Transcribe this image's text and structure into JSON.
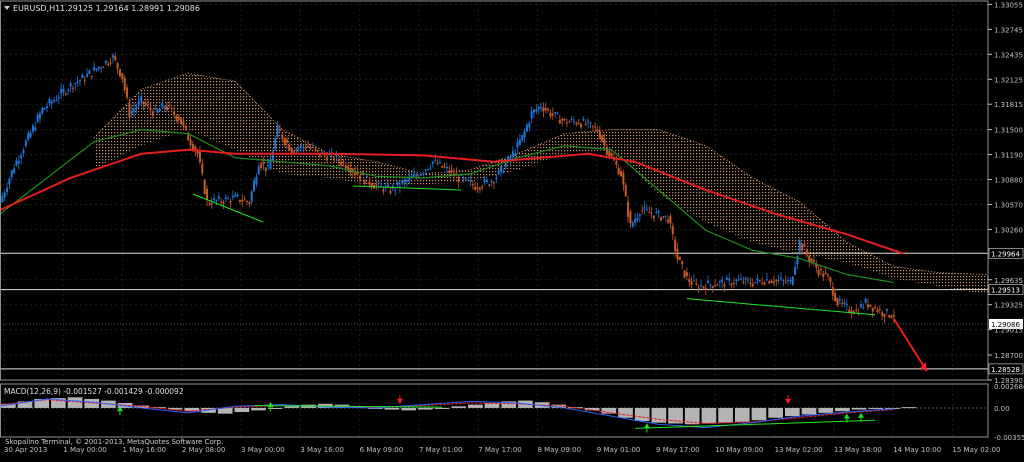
{
  "window": {
    "title": "EURUSD,H1",
    "ohlc": "1.29125 1.29164 1.28991 1.29086"
  },
  "colors": {
    "background": "#000000",
    "grid": "#1e1e1e",
    "axis": "#c0c0c0",
    "candle_up": "#1e78dc",
    "candle_down": "#c85a28",
    "ma_fast": "#1e8c1e",
    "ma_slow": "#e61e1e",
    "cloud": "#e6a078",
    "macd_hist": "#b4b4b4",
    "macd_signal": "#e61e1e",
    "macd_line": "#2d64ff",
    "trendline_green": "#1ee61e",
    "arrow_red": "#ff1e1e",
    "current_price_bg": "#ffffff",
    "current_price_text": "#000000"
  },
  "chart_data": [
    {
      "type": "candlestick",
      "symbol": "EURUSD",
      "timeframe": "H1",
      "ylim": [
        1.2839,
        1.3306
      ],
      "y_ticks": [
        "1.33055",
        "1.32745",
        "1.32435",
        "1.32125",
        "1.31815",
        "1.31500",
        "1.31190",
        "1.30880",
        "1.30570",
        "1.30260",
        "1.29635",
        "1.29325",
        "1.29015",
        "1.28700",
        "1.28390"
      ],
      "x_ticks": [
        "30 Apr 2013",
        "1 May 00:00",
        "1 May 16:00",
        "2 May 08:00",
        "3 May 00:00",
        "3 May 16:00",
        "6 May 09:00",
        "7 May 01:00",
        "7 May 17:00",
        "8 May 09:00",
        "9 May 01:00",
        "9 May 17:00",
        "10 May 09:00",
        "13 May 02:00",
        "13 May 18:00",
        "14 May 10:00",
        "15 May 02:00"
      ],
      "horizontal_levels": [
        {
          "value": 1.29964,
          "label": "1.29964"
        },
        {
          "value": 1.29513,
          "label": "1.29513"
        },
        {
          "value": 1.28528,
          "label": "1.28528"
        }
      ],
      "current_price": {
        "value": 1.29086,
        "label": "1.29086"
      },
      "close_path": [
        [
          0,
          1.306
        ],
        [
          6,
          1.3105
        ],
        [
          12,
          1.314
        ],
        [
          18,
          1.3175
        ],
        [
          24,
          1.319
        ],
        [
          30,
          1.3205
        ],
        [
          36,
          1.3215
        ],
        [
          42,
          1.3228
        ],
        [
          48,
          1.324
        ],
        [
          52,
          1.3215
        ],
        [
          55,
          1.317
        ],
        [
          60,
          1.3185
        ],
        [
          66,
          1.317
        ],
        [
          70,
          1.318
        ],
        [
          76,
          1.3165
        ],
        [
          80,
          1.314
        ],
        [
          84,
          1.312
        ],
        [
          88,
          1.306
        ],
        [
          94,
          1.3062
        ],
        [
          100,
          1.3065
        ],
        [
          106,
          1.306
        ],
        [
          110,
          1.311
        ],
        [
          114,
          1.31
        ],
        [
          118,
          1.315
        ],
        [
          124,
          1.3125
        ],
        [
          130,
          1.313
        ],
        [
          136,
          1.312
        ],
        [
          142,
          1.3115
        ],
        [
          148,
          1.3105
        ],
        [
          154,
          1.309
        ],
        [
          160,
          1.308
        ],
        [
          166,
          1.3075
        ],
        [
          172,
          1.3085
        ],
        [
          178,
          1.3095
        ],
        [
          184,
          1.311
        ],
        [
          190,
          1.31
        ],
        [
          196,
          1.3088
        ],
        [
          202,
          1.308
        ],
        [
          208,
          1.3085
        ],
        [
          212,
          1.3095
        ],
        [
          218,
          1.312
        ],
        [
          222,
          1.314
        ],
        [
          226,
          1.317
        ],
        [
          230,
          1.318
        ],
        [
          234,
          1.317
        ],
        [
          240,
          1.316
        ],
        [
          246,
          1.316
        ],
        [
          250,
          1.3155
        ],
        [
          254,
          1.315
        ],
        [
          258,
          1.3125
        ],
        [
          264,
          1.3095
        ],
        [
          268,
          1.303
        ],
        [
          272,
          1.305
        ],
        [
          278,
          1.3045
        ],
        [
          284,
          1.304
        ],
        [
          288,
          1.299
        ],
        [
          292,
          1.2965
        ],
        [
          296,
          1.2955
        ],
        [
          302,
          1.2958
        ],
        [
          308,
          1.296
        ],
        [
          314,
          1.2962
        ],
        [
          320,
          1.296
        ],
        [
          326,
          1.2964
        ],
        [
          332,
          1.2962
        ],
        [
          336,
          1.296
        ],
        [
          340,
          1.301
        ],
        [
          344,
          1.299
        ],
        [
          348,
          1.2975
        ],
        [
          352,
          1.2965
        ],
        [
          356,
          1.2935
        ],
        [
          360,
          1.2928
        ],
        [
          364,
          1.2925
        ],
        [
          368,
          1.2935
        ],
        [
          372,
          1.2928
        ],
        [
          376,
          1.2922
        ],
        [
          380,
          1.292
        ]
      ],
      "ma_fast_path": [
        [
          0,
          1.3045
        ],
        [
          20,
          1.309
        ],
        [
          40,
          1.3135
        ],
        [
          60,
          1.315
        ],
        [
          80,
          1.3145
        ],
        [
          100,
          1.3115
        ],
        [
          120,
          1.311
        ],
        [
          140,
          1.3105
        ],
        [
          160,
          1.3092
        ],
        [
          180,
          1.309
        ],
        [
          200,
          1.3095
        ],
        [
          220,
          1.3115
        ],
        [
          240,
          1.313
        ],
        [
          260,
          1.3125
        ],
        [
          280,
          1.3075
        ],
        [
          300,
          1.3025
        ],
        [
          320,
          1.3
        ],
        [
          340,
          1.299
        ],
        [
          360,
          1.297
        ],
        [
          380,
          1.296
        ]
      ],
      "ma_slow_path": [
        [
          0,
          1.305
        ],
        [
          30,
          1.309
        ],
        [
          60,
          1.312
        ],
        [
          80,
          1.3125
        ],
        [
          100,
          1.312
        ],
        [
          140,
          1.312
        ],
        [
          180,
          1.3118
        ],
        [
          210,
          1.311
        ],
        [
          230,
          1.3115
        ],
        [
          250,
          1.312
        ],
        [
          270,
          1.311
        ],
        [
          300,
          1.3075
        ],
        [
          330,
          1.3045
        ],
        [
          360,
          1.302
        ],
        [
          384,
          1.2996
        ]
      ],
      "cloud_upper": [
        [
          40,
          1.314
        ],
        [
          60,
          1.32
        ],
        [
          80,
          1.322
        ],
        [
          100,
          1.321
        ],
        [
          120,
          1.315
        ],
        [
          140,
          1.312
        ],
        [
          160,
          1.311
        ],
        [
          180,
          1.3095
        ],
        [
          200,
          1.31
        ],
        [
          220,
          1.312
        ],
        [
          240,
          1.3145
        ],
        [
          260,
          1.315
        ],
        [
          280,
          1.315
        ],
        [
          300,
          1.313
        ],
        [
          320,
          1.309
        ],
        [
          340,
          1.306
        ],
        [
          360,
          1.301
        ],
        [
          380,
          1.298
        ],
        [
          400,
          1.2972
        ],
        [
          420,
          1.297
        ]
      ],
      "cloud_lower": [
        [
          40,
          1.31
        ],
        [
          60,
          1.313
        ],
        [
          80,
          1.315
        ],
        [
          100,
          1.3125
        ],
        [
          120,
          1.3095
        ],
        [
          140,
          1.309
        ],
        [
          160,
          1.308
        ],
        [
          180,
          1.3082
        ],
        [
          200,
          1.3085
        ],
        [
          220,
          1.31
        ],
        [
          240,
          1.312
        ],
        [
          260,
          1.3125
        ],
        [
          280,
          1.307
        ],
        [
          300,
          1.3035
        ],
        [
          320,
          1.301
        ],
        [
          340,
          1.2995
        ],
        [
          360,
          1.2985
        ],
        [
          380,
          1.2965
        ],
        [
          400,
          1.2955
        ],
        [
          420,
          1.2945
        ]
      ],
      "trendlines": [
        {
          "from": [
            292,
            1.294
          ],
          "to": [
            372,
            1.292
          ]
        },
        {
          "from": [
            82,
            1.307
          ],
          "to": [
            112,
            1.3035
          ]
        },
        {
          "from": [
            150,
            1.308
          ],
          "to": [
            196,
            1.3075
          ]
        }
      ],
      "projection_arrow": {
        "from": [
          380,
          1.2915
        ],
        "to": [
          394,
          1.285
        ]
      }
    },
    {
      "type": "histogram",
      "title": "MACD(12,26,9) -0.001527 -0.001429 -0.000092",
      "ylim": [
        -0.00355,
        0.00268
      ],
      "y_ticks": [
        "0.002686",
        "0.00",
        "-0.003555"
      ],
      "bars": [
        0.0005,
        0.0008,
        0.0011,
        0.0012,
        0.0013,
        0.0011,
        0.0009,
        0.0006,
        0.0003,
        0.0001,
        -0.0002,
        -0.0004,
        -0.0006,
        -0.0007,
        -0.0005,
        -0.0003,
        -0.0001,
        0.0002,
        0.0004,
        0.0005,
        0.0004,
        0.0002,
        0.0,
        -0.0002,
        -0.0003,
        -0.0002,
        0.0,
        0.0002,
        0.0004,
        0.0006,
        0.0008,
        0.0009,
        0.0007,
        0.0004,
        0.0001,
        -0.0003,
        -0.0007,
        -0.0012,
        -0.0016,
        -0.0018,
        -0.0019,
        -0.002,
        -0.0019,
        -0.0018,
        -0.0017,
        -0.0015,
        -0.0012,
        -0.001,
        -0.0008,
        -0.0006,
        -0.0004,
        -0.0002,
        -0.0001,
        0.0,
        0.0001
      ],
      "signal_path": [
        [
          0,
          0.0004
        ],
        [
          20,
          0.001
        ],
        [
          40,
          0.0006
        ],
        [
          60,
          0.0002
        ],
        [
          80,
          -0.0004
        ],
        [
          100,
          0.0001
        ],
        [
          120,
          0.0003
        ],
        [
          140,
          0.0002
        ],
        [
          160,
          0.0001
        ],
        [
          180,
          0.0003
        ],
        [
          200,
          0.0006
        ],
        [
          220,
          0.0005
        ],
        [
          240,
          0.0002
        ],
        [
          260,
          -0.0006
        ],
        [
          280,
          -0.0014
        ],
        [
          300,
          -0.0019
        ],
        [
          320,
          -0.0017
        ],
        [
          340,
          -0.0012
        ],
        [
          360,
          -0.0006
        ],
        [
          380,
          -0.0002
        ]
      ],
      "macd_path": [
        [
          0,
          0.0002
        ],
        [
          20,
          0.0011
        ],
        [
          40,
          0.0007
        ],
        [
          60,
          0.0
        ],
        [
          80,
          -0.0006
        ],
        [
          100,
          0.0002
        ],
        [
          120,
          0.0004
        ],
        [
          140,
          0.0001
        ],
        [
          160,
          0.0
        ],
        [
          180,
          0.0004
        ],
        [
          200,
          0.0008
        ],
        [
          220,
          0.0006
        ],
        [
          240,
          0.0
        ],
        [
          260,
          -0.001
        ],
        [
          280,
          -0.002
        ],
        [
          300,
          -0.0024
        ],
        [
          320,
          -0.0018
        ],
        [
          340,
          -0.001
        ],
        [
          360,
          -0.0005
        ],
        [
          380,
          -0.0001
        ]
      ],
      "trendlines": [
        {
          "from": [
            108,
            0.0003
          ],
          "to": [
            188,
            0.0001
          ]
        },
        {
          "from": [
            270,
            -0.0025
          ],
          "to": [
            372,
            -0.0015
          ]
        }
      ],
      "up_arrows": [
        [
          51,
          -0.0004
        ],
        [
          115,
          0.0001
        ],
        [
          275,
          -0.0025
        ],
        [
          360,
          -0.0013
        ],
        [
          366,
          -0.0012
        ]
      ],
      "down_arrows": [
        [
          170,
          0.0011
        ],
        [
          335,
          0.0011
        ]
      ]
    }
  ],
  "footer": {
    "copyright": "Skopalino Terminal, © 2001-2013, MetaQuotes Software Corp."
  }
}
